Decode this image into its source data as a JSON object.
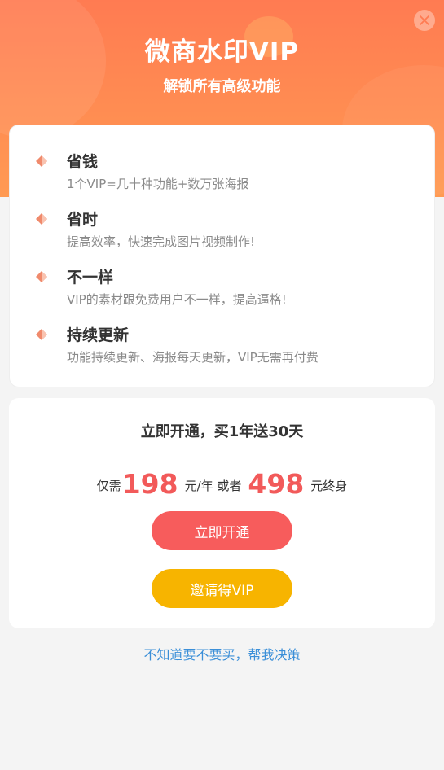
{
  "header": {
    "title": "微商水印VIP",
    "subtitle": "解锁所有高级功能",
    "close_icon": "close-icon",
    "gradient_colors": [
      "#ff7b52",
      "#ff9a52"
    ]
  },
  "features": [
    {
      "title": "省钱",
      "desc": "1个VIP=几十种功能+数万张海报",
      "icon": "diamond-icon"
    },
    {
      "title": "省时",
      "desc": "提高效率，快速完成图片视频制作!",
      "icon": "diamond-icon"
    },
    {
      "title": "不一样",
      "desc": "VIP的素材跟免费用户不一样，提高逼格!",
      "icon": "diamond-icon"
    },
    {
      "title": "持续更新",
      "desc": "功能持续更新、海报每天更新，VIP无需再付费",
      "icon": "diamond-icon"
    }
  ],
  "pricing": {
    "headline": "立即开通，买1年送30天",
    "prefix": "仅需",
    "yearly_price": "198",
    "yearly_unit": "元/年 或者",
    "lifetime_price": "498",
    "lifetime_unit": "元终身",
    "price_color": "#f25a5a"
  },
  "buttons": {
    "open_label": "立即开通",
    "open_color": "#f75c5c",
    "invite_label": "邀请得VIP",
    "invite_color": "#f7b400"
  },
  "help_link": "不知道要不要买，帮我决策"
}
